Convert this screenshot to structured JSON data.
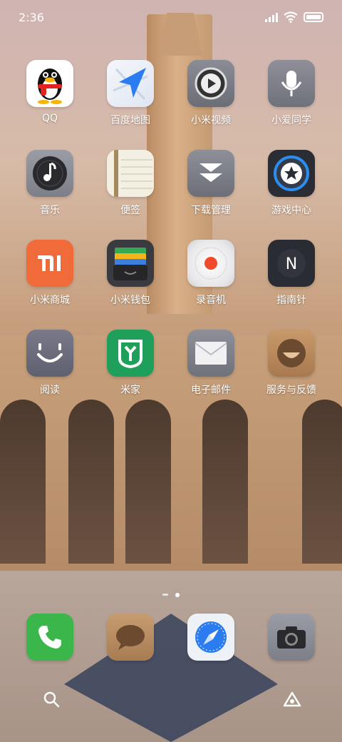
{
  "status_bar": {
    "time": "2:36"
  },
  "apps": [
    {
      "label": "QQ",
      "icon": "qq-penguin-icon"
    },
    {
      "label": "百度地图",
      "icon": "baidu-map-icon"
    },
    {
      "label": "小米视频",
      "icon": "video-play-icon"
    },
    {
      "label": "小爱同学",
      "icon": "microphone-icon"
    },
    {
      "label": "音乐",
      "icon": "music-note-icon"
    },
    {
      "label": "便签",
      "icon": "notes-icon"
    },
    {
      "label": "下载管理",
      "icon": "download-icon"
    },
    {
      "label": "游戏中心",
      "icon": "game-star-icon"
    },
    {
      "label": "小米商城",
      "icon": "mi-logo-icon"
    },
    {
      "label": "小米钱包",
      "icon": "wallet-icon"
    },
    {
      "label": "录音机",
      "icon": "record-icon"
    },
    {
      "label": "指南针",
      "icon": "compass-n-icon"
    },
    {
      "label": "阅读",
      "icon": "reader-face-icon"
    },
    {
      "label": "米家",
      "icon": "mijia-icon"
    },
    {
      "label": "电子邮件",
      "icon": "mail-icon"
    },
    {
      "label": "服务与反馈",
      "icon": "feedback-smile-icon"
    }
  ],
  "dock": [
    {
      "icon": "phone-icon"
    },
    {
      "icon": "message-bubble-icon"
    },
    {
      "icon": "browser-compass-icon"
    },
    {
      "icon": "camera-icon"
    }
  ],
  "page_indicator": {
    "pages": 2,
    "current": 2
  },
  "bottom_bar": {
    "left": "search-icon",
    "right": "assistant-icon"
  },
  "colors": {
    "mi_orange": "#f06a3a",
    "mijia_green": "#1fa05a",
    "game_blue": "#2b8ef0",
    "phone_green": "#3bb64a",
    "map_blue": "#2a7cf0"
  }
}
